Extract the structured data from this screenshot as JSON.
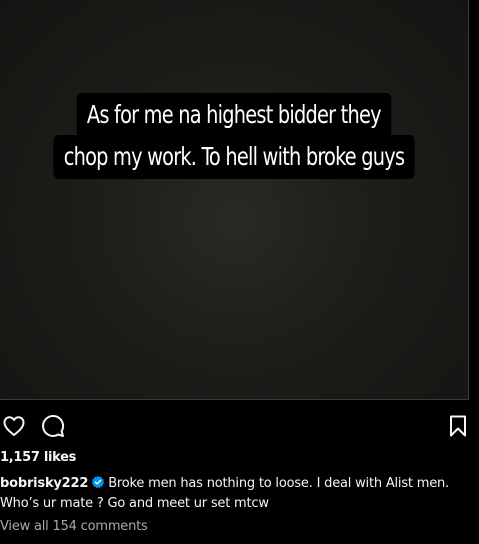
{
  "post": {
    "image_text": {
      "line1": "As for me na highest bidder they",
      "line2": "chop my work. To hell with broke guys"
    }
  },
  "actions": {
    "like_icon": "heart-icon",
    "comment_icon": "comment-icon",
    "save_icon": "bookmark-icon"
  },
  "likes": "1,157 likes",
  "caption": {
    "username": "bobrisky222",
    "verified_icon": "verified-badge-icon",
    "text": "Broke men has nothing to loose. I deal with Alist men. Who’s ur mate ? Go and meet ur set mtcw"
  },
  "comments_link": "View all 154 comments",
  "colors": {
    "background": "#000000",
    "text": "#f5f5f5",
    "muted": "#a8a8a8",
    "verified": "#0095f6"
  }
}
